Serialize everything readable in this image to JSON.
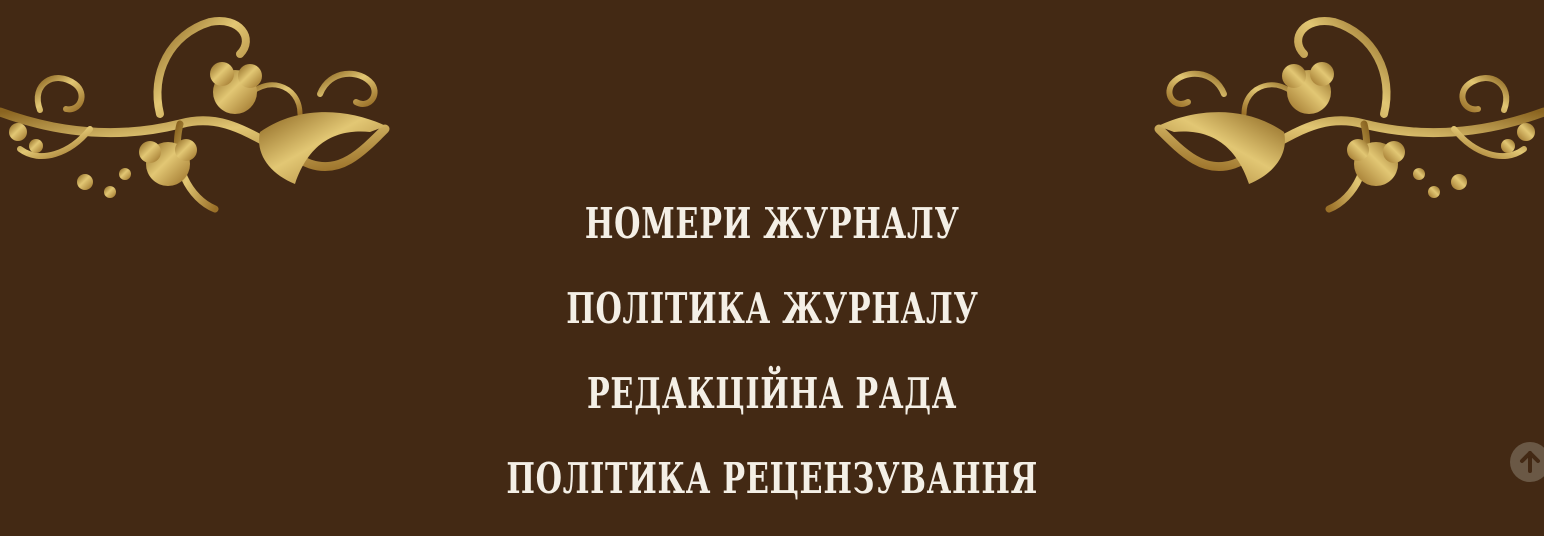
{
  "menu": {
    "items": [
      {
        "label": "НОМЕРИ ЖУРНАЛУ"
      },
      {
        "label": "ПОЛІТИКА ЖУРНАЛУ"
      },
      {
        "label": "РЕДАКЦІЙНА РАДА"
      },
      {
        "label": "ПОЛІТИКА РЕЦЕНЗУВАННЯ"
      }
    ]
  },
  "icons": {
    "ornament": "golden-floral-bird-ornament-icon",
    "scroll_top": "arrow-up-icon"
  },
  "colors": {
    "background": "#432914",
    "text": "#f4efe6",
    "gold": "#c9a24a",
    "scroll_button": "#6a5845"
  }
}
